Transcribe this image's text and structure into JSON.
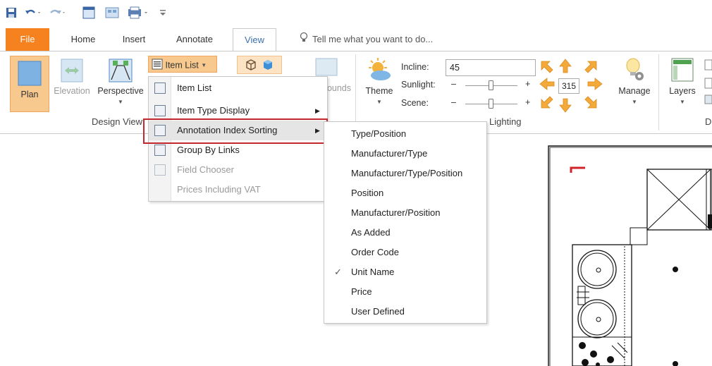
{
  "tabs": {
    "file": "File",
    "home": "Home",
    "insert": "Insert",
    "annotate": "Annotate",
    "view": "View",
    "tell_me": "Tell me what you want to do..."
  },
  "ribbon": {
    "design_view": {
      "group_label": "Design View",
      "plan": "Plan",
      "elevation": "Elevation",
      "perspective": "Perspective",
      "item_list": "Item List",
      "bounds_partial": "ounds"
    },
    "lighting": {
      "group_label": "Lighting",
      "theme": "Theme",
      "incline_label": "Incline:",
      "incline_value": "45",
      "sunlight_label": "Sunlight:",
      "scene_label": "Scene:",
      "minus": "–",
      "plus": "+",
      "azimuth_value": "315",
      "manage": "Manage"
    },
    "layers": "Layers",
    "partial_group_label": "D"
  },
  "item_list_menu": {
    "items": [
      {
        "label": "Item List",
        "enabled": true,
        "submenu": false
      },
      {
        "label": "Item Type Display",
        "enabled": true,
        "submenu": true
      },
      {
        "label": "Annotation Index Sorting",
        "enabled": true,
        "submenu": true,
        "highlighted": true
      },
      {
        "label": "Group By Links",
        "enabled": true,
        "submenu": false
      },
      {
        "label": "Field Chooser",
        "enabled": false,
        "submenu": false
      },
      {
        "label": "Prices Including VAT",
        "enabled": false,
        "submenu": false
      }
    ]
  },
  "sorting_submenu": {
    "items": [
      {
        "label": "Type/Position",
        "checked": false
      },
      {
        "label": "Manufacturer/Type",
        "checked": false
      },
      {
        "label": "Manufacturer/Type/Position",
        "checked": false
      },
      {
        "label": "Position",
        "checked": false
      },
      {
        "label": "Manufacturer/Position",
        "checked": false
      },
      {
        "label": "As Added",
        "checked": false
      },
      {
        "label": "Order Code",
        "checked": false
      },
      {
        "label": "Unit Name",
        "checked": true
      },
      {
        "label": "Price",
        "checked": false
      },
      {
        "label": "User Defined",
        "checked": false
      }
    ],
    "check_glyph": "✓"
  },
  "colors": {
    "file_tab": "#f5821f",
    "active_tab_text": "#3a6fb0",
    "highlight_border": "#c4262e",
    "plan_button_bg": "#f7c98f"
  }
}
